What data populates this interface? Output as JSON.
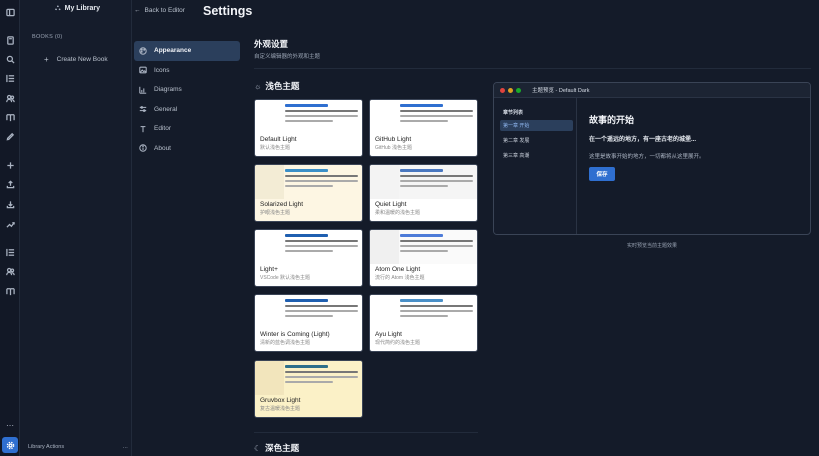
{
  "window": {
    "back_label": "Back to Editor",
    "title": "Settings"
  },
  "library": {
    "title": "My Library",
    "books_label": "BOOKS (0)",
    "create_label": "Create New Book",
    "actions_label": "Library Actions",
    "actions_more": "…"
  },
  "settings_nav": [
    {
      "label": "Appearance",
      "icon": "palette-icon",
      "active": true
    },
    {
      "label": "Icons",
      "icon": "image-icon",
      "active": false
    },
    {
      "label": "Diagrams",
      "icon": "chart-icon",
      "active": false
    },
    {
      "label": "General",
      "icon": "sliders-icon",
      "active": false
    },
    {
      "label": "Editor",
      "icon": "text-icon",
      "active": false
    },
    {
      "label": "About",
      "icon": "info-icon",
      "active": false
    }
  ],
  "appearance": {
    "title": "外观设置",
    "subtitle": "自定义编辑器的外观和主题",
    "light_group": "浅色主题",
    "dark_group": "深色主题"
  },
  "themes": [
    {
      "name": "Default Light",
      "desc": "默认浅色主题",
      "strip": "#ffffff",
      "pane": "#ffffff",
      "bg": "#ffffff",
      "accent": "#2f6fd0"
    },
    {
      "name": "GitHub Light",
      "desc": "GitHub 浅色主题",
      "strip": "#ffffff",
      "pane": "#ffffff",
      "bg": "#ffffff",
      "accent": "#2f6fd0"
    },
    {
      "name": "Solarized Light",
      "desc": "护眼浅色主题",
      "strip": "#f3ecd5",
      "pane": "#fdf6e3",
      "bg": "#fdf6e3",
      "accent": "#3a8fc8"
    },
    {
      "name": "Quiet Light",
      "desc": "柔和温暖的浅色主题",
      "strip": "#f3f3f3",
      "pane": "#f5f5f5",
      "bg": "#ffffff",
      "accent": "#4a78c0"
    },
    {
      "name": "Light+",
      "desc": "VSCode 默认浅色主题",
      "strip": "#ffffff",
      "pane": "#ffffff",
      "bg": "#ffffff",
      "accent": "#1f5fb0"
    },
    {
      "name": "Atom One Light",
      "desc": "流行的 Atom 浅色主题",
      "strip": "#f0f0f0",
      "pane": "#fafafa",
      "bg": "#ffffff",
      "accent": "#4d7bd8"
    },
    {
      "name": "Winter is Coming (Light)",
      "desc": "清新的蓝色调浅色主题",
      "strip": "#ffffff",
      "pane": "#ffffff",
      "bg": "#ffffff",
      "accent": "#1f5fb0"
    },
    {
      "name": "Ayu Light",
      "desc": "现代简约的浅色主题",
      "strip": "#ffffff",
      "pane": "#ffffff",
      "bg": "#ffffff",
      "accent": "#4a90c8"
    },
    {
      "name": "Gruvbox Light",
      "desc": "复古温暖浅色主题",
      "strip": "#f2e5bc",
      "pane": "#fbf1c7",
      "bg": "#fbf1c7",
      "accent": "#2e6f8a"
    }
  ],
  "preview": {
    "window_title": "主题预览 - Default Dark",
    "sidebar_heading": "章节列表",
    "chapters": [
      "第一章 开始",
      "第二章 发展",
      "第三章 高潮"
    ],
    "heading": "故事的开始",
    "lead": "在一个遥远的地方，有一座古老的城堡...",
    "body": "这里是故事开始的地方，一切都将从这里展开。",
    "button": "保存",
    "caption": "实时预览当前主题效果"
  }
}
